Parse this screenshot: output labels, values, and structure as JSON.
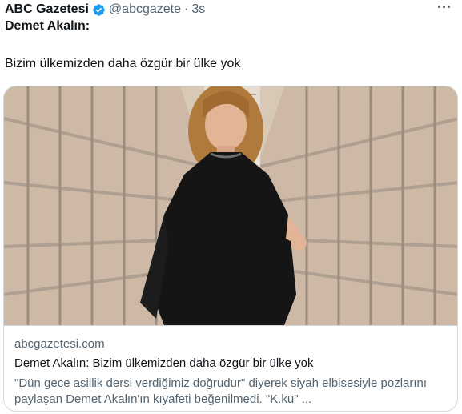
{
  "tweet": {
    "display_name": "ABC Gazetesi",
    "handle": "@abcgazete",
    "separator": "·",
    "time": "3s",
    "verified_icon": "verified-badge-icon",
    "more_icon": "more-options-icon",
    "lead_text": "Demet Akalın:",
    "quote_text": "Bizim ülkemizden daha özgür bir ülke yok"
  },
  "card": {
    "image_desc_icon": "link-preview-photo",
    "domain": "abcgazetesi.com",
    "title": "Demet Akalın: Bizim ülkemizden daha özgür bir ülke yok",
    "description": "\"Dün gece asillik dersi verdiğimiz doğrudur\" diyerek siyah elbisesiyle pozlarını paylaşan Demet Akalın'ın kıyafeti beğenilmedi. \"K.ku\" ..."
  },
  "colors": {
    "text_primary": "#0f1419",
    "text_secondary": "#536471",
    "verified_blue": "#1d9bf0",
    "border": "#cfd9de",
    "dress": "#151515",
    "wall": "#d9c9b8"
  }
}
